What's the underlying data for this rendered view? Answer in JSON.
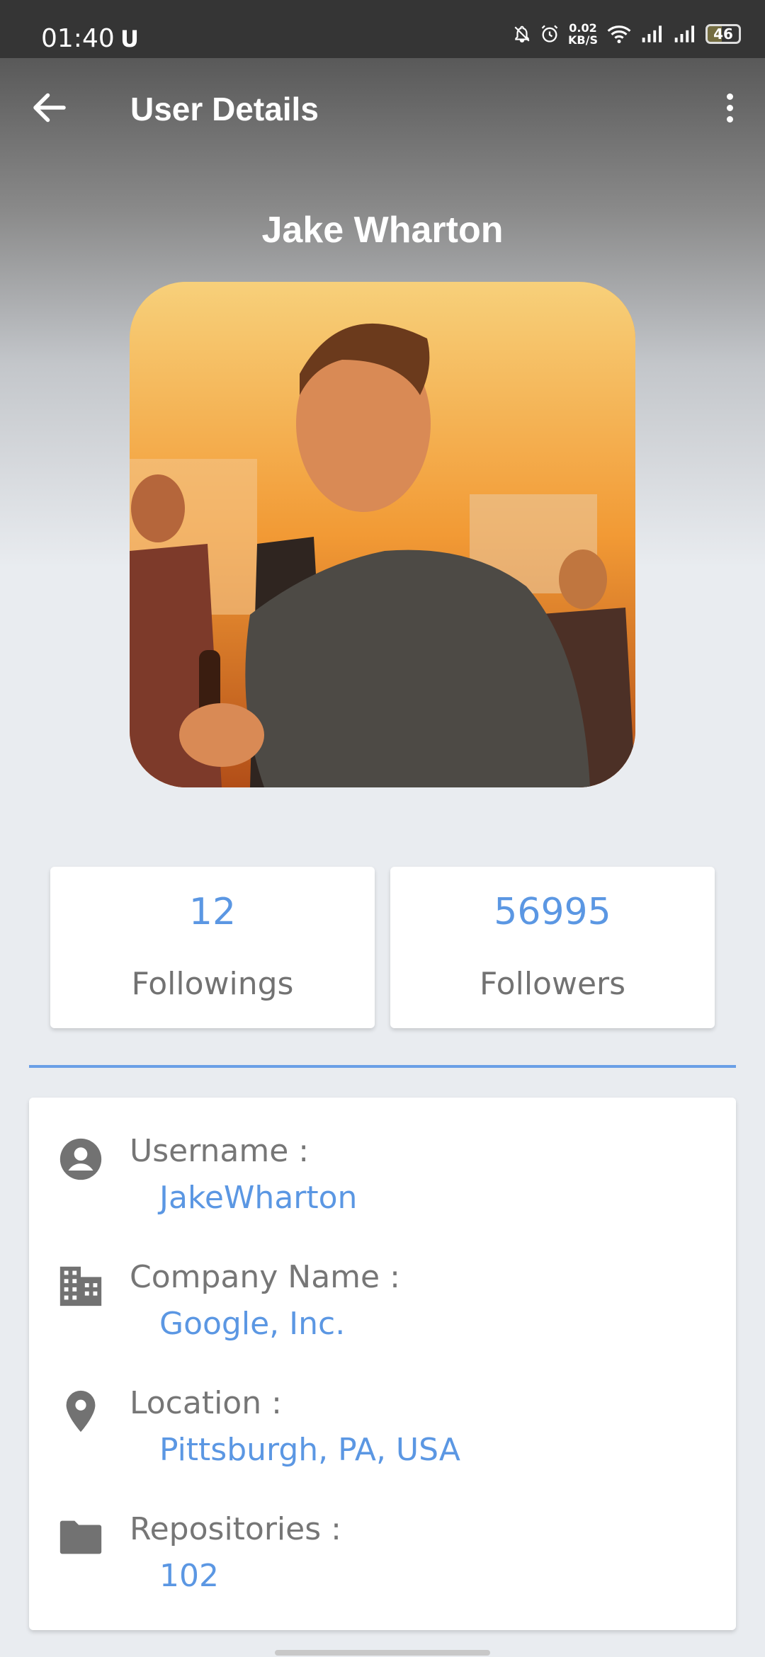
{
  "status_bar": {
    "time": "01:40",
    "carrier_glyph": "U",
    "net_speed_value": "0.02",
    "net_speed_unit": "KB/S",
    "battery": "46",
    "icons": [
      "bell-off-icon",
      "alarm-icon",
      "wifi-icon",
      "signal-icon",
      "signal-icon"
    ]
  },
  "appbar": {
    "title": "User Details",
    "back_icon": "arrow-left-icon",
    "menu_icon": "more-vertical-icon"
  },
  "profile": {
    "name": "Jake Wharton",
    "avatar_icon": "avatar-photo"
  },
  "stats": [
    {
      "value": "12",
      "label": "Followings"
    },
    {
      "value": "56995",
      "label": "Followers"
    }
  ],
  "details": [
    {
      "icon": "account-circle-icon",
      "label": "Username :",
      "value": "JakeWharton"
    },
    {
      "icon": "building-icon",
      "label": "Company Name :",
      "value": "Google, Inc."
    },
    {
      "icon": "location-pin-icon",
      "label": "Location :",
      "value": "Pittsburgh, PA, USA"
    },
    {
      "icon": "folder-icon",
      "label": "Repositories :",
      "value": "102"
    }
  ],
  "colors": {
    "accent": "#5b97e3",
    "label_gray": "#767676",
    "status_bar": "#353535"
  }
}
